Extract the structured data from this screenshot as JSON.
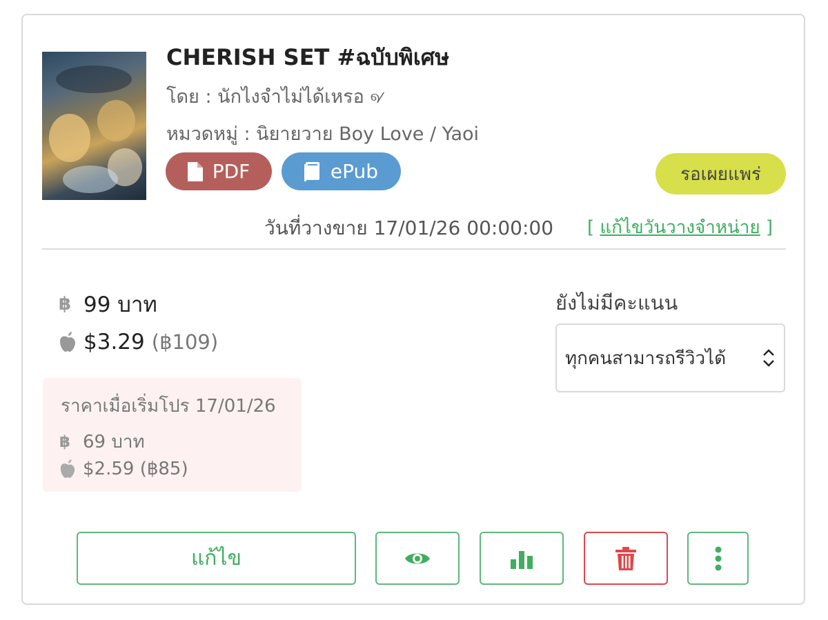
{
  "book": {
    "title": "CHERISH SET #ฉบับพิเศษ",
    "author": "โดย : นักไงจำไม่ได้เหรอ ୶",
    "category": "หมวดหมู่ : นิยายวาย Boy Love / Yaoi"
  },
  "formats": {
    "pdf_label": "PDF",
    "epub_label": "ePub"
  },
  "status": {
    "label": "รอเผยแพร่",
    "color": "#d7df4a"
  },
  "release": {
    "text": "วันที่วางขาย 17/01/26 00:00:00",
    "edit_open": "[",
    "edit_link": "แก้ไขวันวางจำหน่าย",
    "edit_close": "]"
  },
  "price": {
    "baht_symbol": "฿",
    "baht_value": "99 บาท",
    "apple_value": "$3.29",
    "apple_baht": "(฿109)"
  },
  "promo": {
    "title": "ราคาเมื่อเริ่มโปร 17/01/26",
    "baht_value": "69 บาท",
    "apple_value": "$2.59 (฿85)"
  },
  "rating": {
    "text": "ยังไม่มีคะแนน"
  },
  "review_select": {
    "selected": "ทุกคนสามารถรีวิวได้"
  },
  "actions": {
    "edit_label": "แก้ไข",
    "view_icon": "eye-icon",
    "stats_icon": "bar-chart-icon",
    "delete_icon": "trash-icon",
    "more_icon": "more-vertical-icon"
  },
  "colors": {
    "pdf": "#b45f5b",
    "epub": "#5a9bd2",
    "accent_green": "#3fae60",
    "danger_red": "#e0464a"
  }
}
